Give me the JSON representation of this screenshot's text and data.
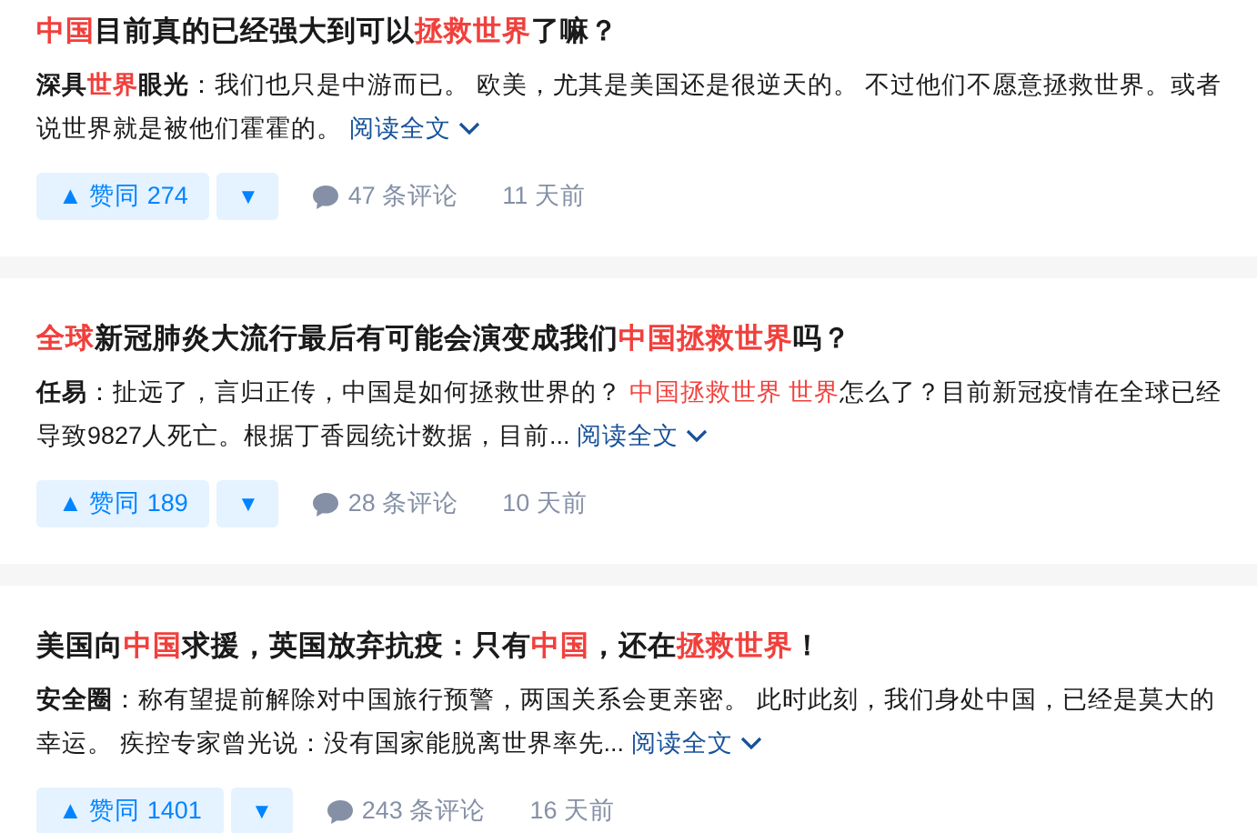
{
  "cards": [
    {
      "title": [
        {
          "text": "中国",
          "highlight": true
        },
        {
          "text": "目前真的已经强大到可以",
          "highlight": false
        },
        {
          "text": "拯救世界",
          "highlight": true
        },
        {
          "text": "了嘛？",
          "highlight": false
        }
      ],
      "author": [
        {
          "text": "深具",
          "highlight": false
        },
        {
          "text": "世界",
          "highlight": true
        },
        {
          "text": "眼光",
          "highlight": false
        }
      ],
      "excerpt": [
        {
          "text": "：我们也只是中游而已。 欧美，尤其是美国还是很逆天的。 不过他们不愿意拯救世界。或者说世界就是被他们霍霍的。",
          "highlight": false
        }
      ],
      "read_more": "阅读全文",
      "upvote": "▲ 赞同 274",
      "downvote": "▼",
      "comments": "47 条评论",
      "time": "11 天前"
    },
    {
      "title": [
        {
          "text": "全球",
          "highlight": true
        },
        {
          "text": "新冠肺炎大流行最后有可能会演变成我们",
          "highlight": false
        },
        {
          "text": "中国拯救世界",
          "highlight": true
        },
        {
          "text": "吗？",
          "highlight": false
        }
      ],
      "author": [
        {
          "text": "任易",
          "highlight": false
        }
      ],
      "excerpt": [
        {
          "text": "：扯远了，言归正传，中国是如何拯救世界的？ ",
          "highlight": false
        },
        {
          "text": "中国拯救世界 世界",
          "highlight": true
        },
        {
          "text": "怎么了？目前新冠疫情在全球已经导致9827人死亡。根据丁香园统计数据，目前...",
          "highlight": false
        }
      ],
      "read_more": "阅读全文",
      "upvote": "▲ 赞同 189",
      "downvote": "▼",
      "comments": "28 条评论",
      "time": "10 天前"
    },
    {
      "title": [
        {
          "text": "美国向",
          "highlight": false
        },
        {
          "text": "中国",
          "highlight": true
        },
        {
          "text": "求援，英国放弃抗疫：只有",
          "highlight": false
        },
        {
          "text": "中国",
          "highlight": true
        },
        {
          "text": "，还在",
          "highlight": false
        },
        {
          "text": "拯救世界",
          "highlight": true
        },
        {
          "text": "！",
          "highlight": false
        }
      ],
      "author": [
        {
          "text": "安全圈",
          "highlight": false
        }
      ],
      "excerpt": [
        {
          "text": "：称有望提前解除对中国旅行预警，两国关系会更亲密。 此时此刻，我们身处中国，已经是莫大的幸运。 疾控专家曾光说：没有国家能脱离世界率先...",
          "highlight": false
        }
      ],
      "read_more": "阅读全文",
      "upvote": "▲ 赞同 1401",
      "downvote": "▼",
      "comments": "243 条评论",
      "time": "16 天前"
    }
  ]
}
